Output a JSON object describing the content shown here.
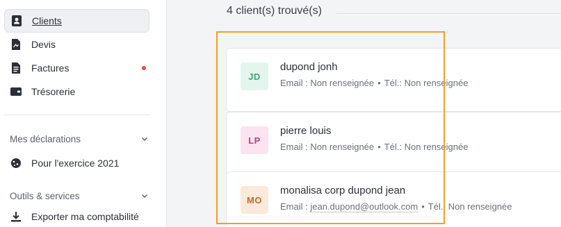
{
  "sidebar": {
    "items": [
      {
        "label": "Clients",
        "icon": "contact-book-icon",
        "active": true
      },
      {
        "label": "Devis",
        "icon": "quote-doc-icon"
      },
      {
        "label": "Factures",
        "icon": "invoice-doc-icon",
        "badge": "red-dot"
      },
      {
        "label": "Trésorerie",
        "icon": "wallet-icon"
      }
    ],
    "declarations": {
      "title": "Mes déclarations",
      "items": [
        {
          "label": "Pour l'exercice 2021",
          "icon": "cookie-icon"
        }
      ]
    },
    "tools": {
      "title": "Outils & services",
      "items": [
        {
          "label": "Exporter ma comptabilité",
          "icon": "download-icon"
        }
      ]
    }
  },
  "main": {
    "result_count": "4 client(s) trouvé(s)",
    "clients": [
      {
        "initials": "JD",
        "name": "dupond jonh",
        "email_label": "Email :",
        "email": "Non renseignée",
        "phone_label": "Tél.:",
        "phone": "Non renseignée",
        "avatar_bg": "#e3f6ee",
        "avatar_fg": "#3aa978"
      },
      {
        "initials": "LP",
        "name": "pierre louis",
        "email_label": "Email :",
        "email": "Non renseignée",
        "phone_label": "Tél.:",
        "phone": "Non renseignée",
        "avatar_bg": "#fbe3ef",
        "avatar_fg": "#c2417f"
      },
      {
        "initials": "MO",
        "name": "monalisa corp dupond jean",
        "email_label": "Email :",
        "email": "jean.dupond@outlook.com",
        "phone_label": "Tél.:",
        "phone": "Non renseignée",
        "avatar_bg": "#fbeadb",
        "avatar_fg": "#c26a2c"
      }
    ]
  },
  "colors": {
    "highlight": "#f0a020",
    "badge": "#e5484d"
  }
}
